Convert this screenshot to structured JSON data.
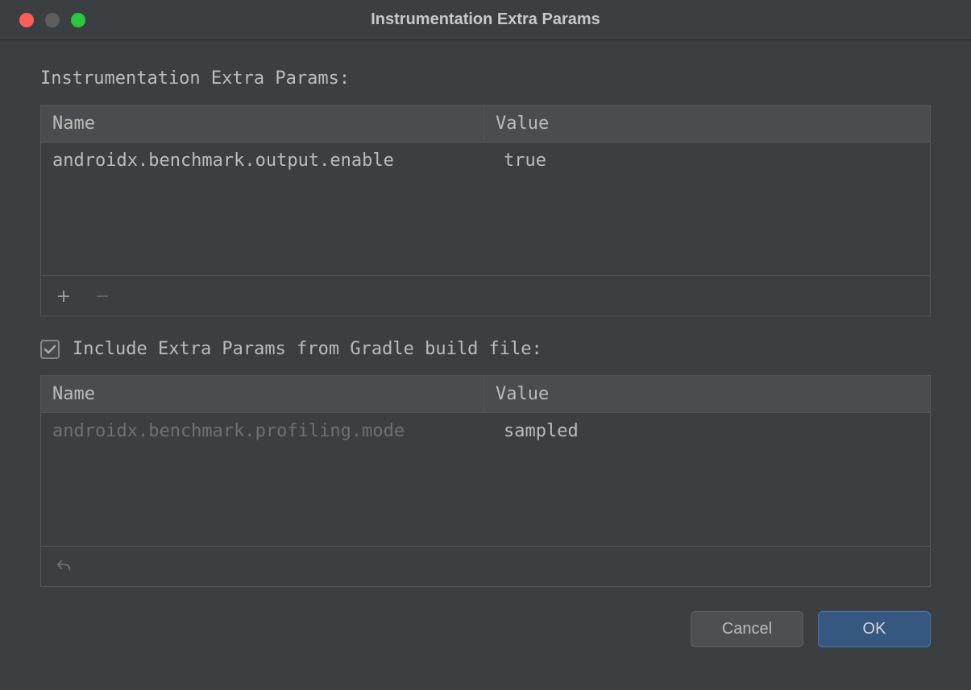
{
  "window": {
    "title": "Instrumentation Extra Params"
  },
  "section1": {
    "label": "Instrumentation Extra Params:",
    "columns": {
      "name": "Name",
      "value": "Value"
    },
    "rows": [
      {
        "name": "androidx.benchmark.output.enable",
        "value": "true"
      }
    ]
  },
  "checkbox": {
    "checked": true,
    "label": "Include Extra Params from Gradle build file:"
  },
  "section2": {
    "columns": {
      "name": "Name",
      "value": "Value"
    },
    "rows": [
      {
        "name": "androidx.benchmark.profiling.mode",
        "value": "sampled"
      }
    ]
  },
  "buttons": {
    "cancel": "Cancel",
    "ok": "OK"
  }
}
